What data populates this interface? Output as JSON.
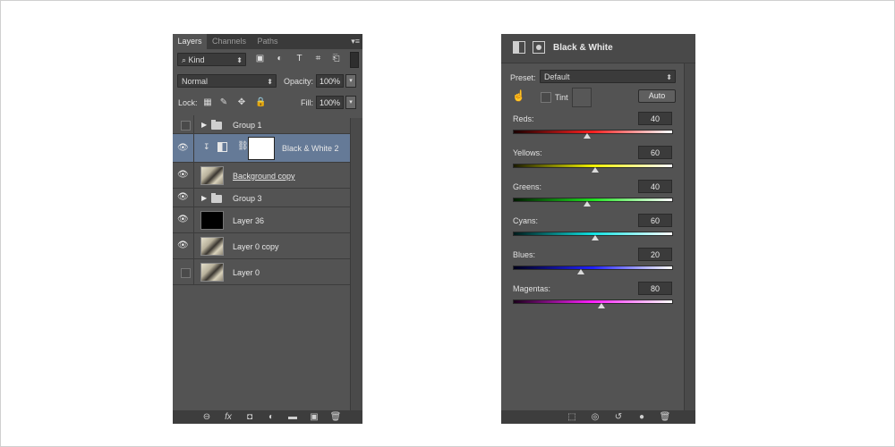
{
  "layers_panel": {
    "tabs": [
      "Layers",
      "Channels",
      "Paths"
    ],
    "active_tab": "Layers",
    "menu_icon": "panel-menu-icon",
    "filter": {
      "kind_label": "Kind",
      "icons": [
        "image-filter-icon",
        "adjustment-filter-icon",
        "type-filter-icon",
        "shape-filter-icon",
        "smart-object-filter-icon"
      ]
    },
    "blend_mode": "Normal",
    "opacity_label": "Opacity:",
    "opacity_value": "100%",
    "lock_label": "Lock:",
    "lock_icons": [
      "lock-transparent-icon",
      "lock-image-icon",
      "lock-position-icon",
      "lock-all-icon"
    ],
    "fill_label": "Fill:",
    "fill_value": "100%",
    "layers": [
      {
        "name": "Group 1",
        "type": "group",
        "visible": false
      },
      {
        "name": "Black & White 2",
        "type": "adjustment",
        "visible": true,
        "selected": true
      },
      {
        "name": "Background copy",
        "type": "image",
        "visible": true
      },
      {
        "name": "Group 3",
        "type": "group",
        "visible": true
      },
      {
        "name": "Layer 36",
        "type": "fill-black",
        "visible": true
      },
      {
        "name": "Layer 0 copy",
        "type": "image",
        "visible": true
      },
      {
        "name": "Layer 0",
        "type": "image",
        "visible": false
      }
    ],
    "footer_icons": [
      "link-layers-icon",
      "fx-icon",
      "add-mask-icon",
      "new-adjustment-icon",
      "new-group-icon",
      "new-layer-icon",
      "trash-icon"
    ],
    "footer_glyphs": [
      "⊖",
      "fx",
      "◘",
      "◐",
      "▬",
      "▣",
      "🗑"
    ]
  },
  "properties_panel": {
    "title": "Black & White",
    "preset_label": "Preset:",
    "preset_value": "Default",
    "tint_label": "Tint",
    "auto_label": "Auto",
    "sliders": [
      {
        "label": "Reds:",
        "value": "40",
        "fraction": 0.47,
        "gradient": [
          "#1a0000",
          "#ff2020",
          "#ffffff"
        ]
      },
      {
        "label": "Yellows:",
        "value": "60",
        "fraction": 0.52,
        "gradient": [
          "#1a1a00",
          "#f0f000",
          "#ffffff"
        ]
      },
      {
        "label": "Greens:",
        "value": "40",
        "fraction": 0.47,
        "gradient": [
          "#001a00",
          "#20e020",
          "#ffffff"
        ]
      },
      {
        "label": "Cyans:",
        "value": "60",
        "fraction": 0.52,
        "gradient": [
          "#001a1a",
          "#10e0e0",
          "#ffffff"
        ]
      },
      {
        "label": "Blues:",
        "value": "20",
        "fraction": 0.43,
        "gradient": [
          "#00001a",
          "#2020ff",
          "#ffffff"
        ]
      },
      {
        "label": "Magentas:",
        "value": "80",
        "fraction": 0.56,
        "gradient": [
          "#1a001a",
          "#ff20ff",
          "#ffffff"
        ]
      }
    ],
    "footer_icons": [
      "clip-to-layer-icon",
      "view-previous-icon",
      "reset-icon",
      "visibility-icon",
      "trash-icon"
    ],
    "footer_glyphs": [
      "⬚",
      "◎",
      "↺",
      "●",
      "🗑"
    ]
  }
}
